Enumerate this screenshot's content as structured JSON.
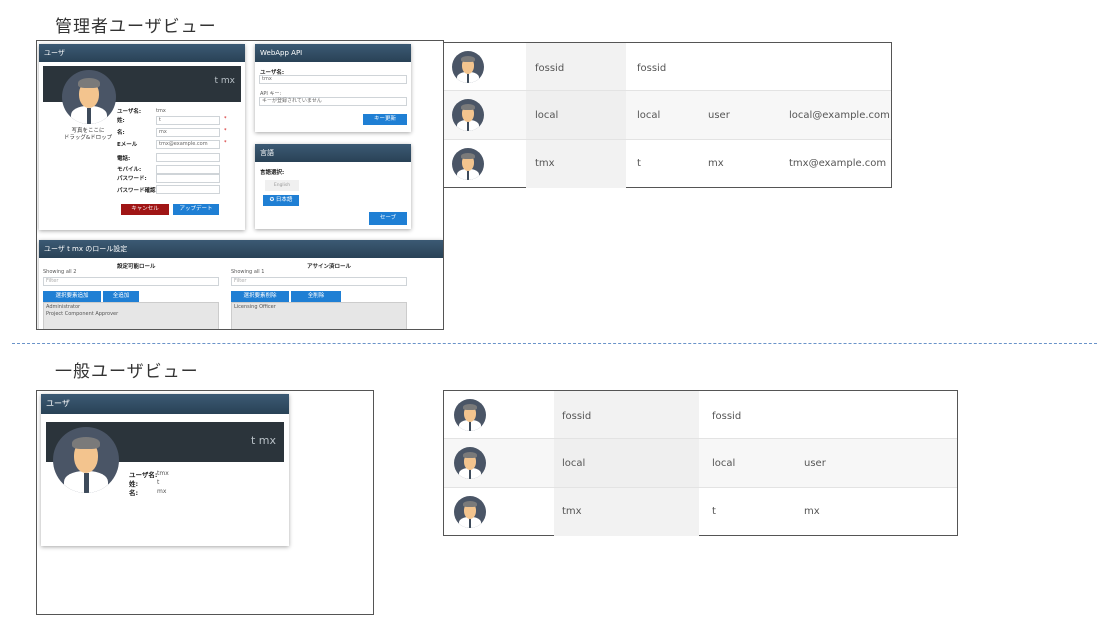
{
  "admin_view": {
    "title": "管理者ユーザビュー",
    "user_panel": {
      "header": "ユーザ",
      "cover_name": "t mx",
      "photo_hint_line1": "写真をここに",
      "photo_hint_line2": "ドラッグ&ドロップ",
      "fields": [
        {
          "label": "ユーザ名:",
          "value": "tmx"
        },
        {
          "label": "姓:",
          "value": "t"
        },
        {
          "label": "名:",
          "value": "mx"
        },
        {
          "label": "Eメール",
          "value": "tmx@example.com"
        },
        {
          "label": "電話:",
          "value": ""
        },
        {
          "label": "モバイル:",
          "value": ""
        },
        {
          "label": "パスワード:",
          "value": ""
        },
        {
          "label": "パスワード確認:",
          "value": ""
        }
      ],
      "required_mark": "*",
      "cancel_label": "キャンセル",
      "update_label": "アップデート"
    },
    "webapp_panel": {
      "header": "WebApp API",
      "username_label": "ユーザ名:",
      "username_value": "tmx",
      "apikey_label": "API キー:",
      "apikey_value": "キーが登録されていません",
      "refresh_label": "キー更新"
    },
    "language_panel": {
      "header": "言語",
      "select_label": "言語選択:",
      "option_english": "English",
      "option_japanese": "日本語",
      "save_label": "セーブ"
    },
    "roles_panel": {
      "header": "ユーザ t mx のロール設定",
      "available_title": "設定可能ロール",
      "assigned_title": "アサイン済ロール",
      "available_showing": "Showing all 2",
      "assigned_showing": "Showing all 1",
      "filter_placeholder": "Filter",
      "add_selected_label": "選択要素追加",
      "add_all_label": "全追加",
      "remove_selected_label": "選択要素削除",
      "remove_all_label": "全削除",
      "available_roles": [
        "Administrator",
        "Project Component Approver"
      ],
      "assigned_roles": [
        "Licensing Officer"
      ]
    },
    "table": {
      "rows": [
        {
          "username": "fossid",
          "first": "fossid",
          "last": "",
          "email": ""
        },
        {
          "username": "local",
          "first": "local",
          "last": "user",
          "email": "local@example.com"
        },
        {
          "username": "tmx",
          "first": "t",
          "last": "mx",
          "email": "tmx@example.com"
        }
      ]
    }
  },
  "general_view": {
    "title": "一般ユーザビュー",
    "user_panel": {
      "header": "ユーザ",
      "cover_name": "t mx",
      "fields": [
        {
          "label": "ユーザ名:",
          "value": "tmx"
        },
        {
          "label": "姓:",
          "value": "t"
        },
        {
          "label": "名:",
          "value": "mx"
        }
      ]
    },
    "table": {
      "rows": [
        {
          "username": "fossid",
          "first": "fossid",
          "last": ""
        },
        {
          "username": "local",
          "first": "local",
          "last": "user"
        },
        {
          "username": "tmx",
          "first": "t",
          "last": "mx"
        }
      ]
    }
  }
}
